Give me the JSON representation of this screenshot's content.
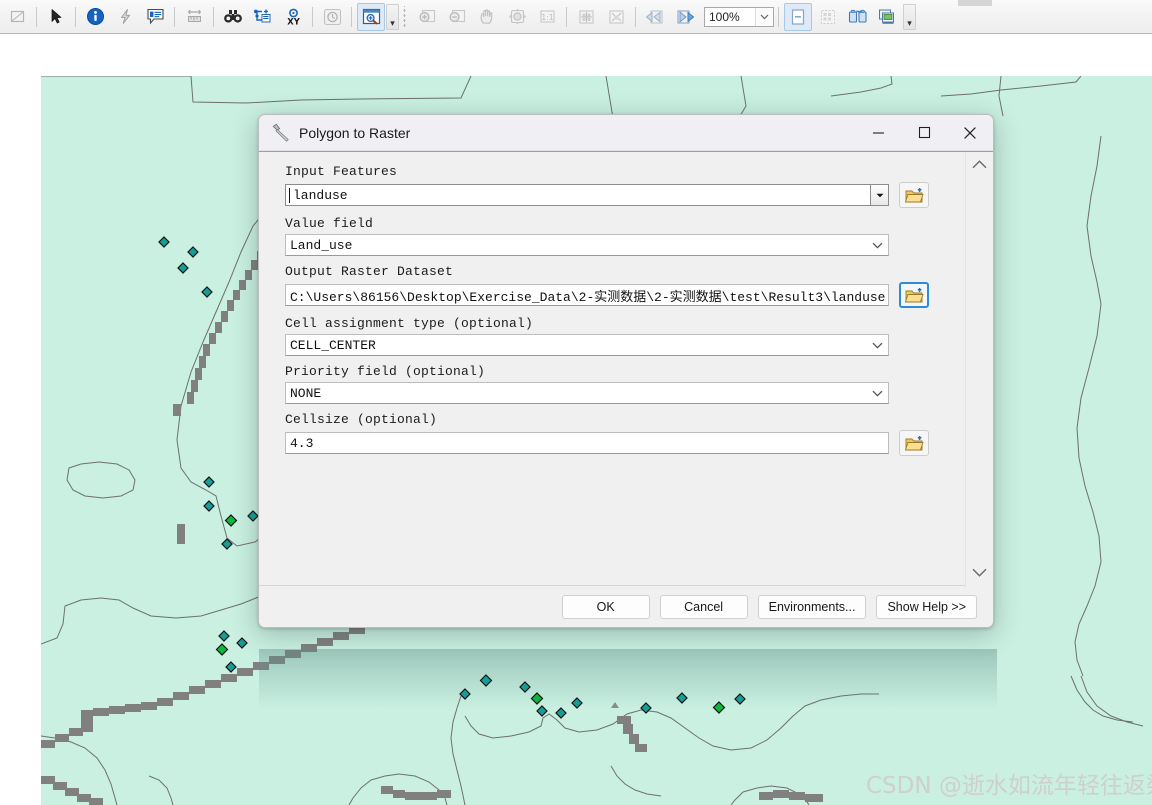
{
  "toolbar": {
    "zoom_level": "100%",
    "items": [
      {
        "icon": "extent-rectangle-icon",
        "label": "Full Extent"
      },
      {
        "icon": "select-arrow-icon",
        "label": "Select Elements"
      },
      {
        "icon": "identify-info-icon",
        "label": "Identify"
      },
      {
        "icon": "hyperlink-lightning-icon",
        "label": "Hyperlink"
      },
      {
        "icon": "html-popup-icon",
        "label": "HTML Popup"
      },
      {
        "icon": "measure-icon",
        "label": "Measure"
      },
      {
        "icon": "find-binoculars-icon",
        "label": "Find"
      },
      {
        "icon": "find-route-icon",
        "label": "Find Route"
      },
      {
        "icon": "go-to-xy-icon",
        "label": "Go To XY"
      },
      {
        "icon": "time-slider-icon",
        "label": "Time Slider"
      },
      {
        "icon": "create-viewer-window-icon",
        "label": "Create Viewer Window"
      },
      {
        "icon": "zoom-in-icon",
        "label": "Zoom In"
      },
      {
        "icon": "zoom-out-icon",
        "label": "Zoom Out"
      },
      {
        "icon": "pan-hand-icon",
        "label": "Pan"
      },
      {
        "icon": "full-extent-globe-icon",
        "label": "Full Extent"
      },
      {
        "icon": "fixed-zoom-1to1-icon",
        "label": "Fixed Zoom"
      },
      {
        "icon": "zoom-in-fixed-icon",
        "label": "Fixed Zoom In"
      },
      {
        "icon": "zoom-out-fixed-icon",
        "label": "Fixed Zoom Out"
      },
      {
        "icon": "go-back-extent-icon",
        "label": "Go Back To Previous Extent"
      },
      {
        "icon": "go-next-extent-icon",
        "label": "Go To Next Extent"
      },
      {
        "icon": "new-page-icon",
        "label": "New Layout"
      },
      {
        "icon": "page-grid-icon",
        "label": "Change Layout"
      },
      {
        "icon": "copy-paste-icon",
        "label": "Copy/Paste"
      },
      {
        "icon": "map-series-icon",
        "label": "Data Driven Pages"
      }
    ]
  },
  "dialog": {
    "title": "Polygon to Raster",
    "title_icon": "hammer-tool-icon",
    "window_buttons": {
      "minimize": "minimize-icon",
      "maximize": "maximize-icon",
      "close": "close-icon"
    },
    "fields": [
      {
        "label": "Input Features",
        "value": "landuse",
        "control": "combobox",
        "has_browse": true,
        "browse_focused": false
      },
      {
        "label": "Value field",
        "value": "Land_use",
        "control": "dropdown",
        "has_browse": false,
        "browse_focused": false
      },
      {
        "label": "Output Raster Dataset",
        "value": "C:\\Users\\86156\\Desktop\\Exercise_Data\\2-实测数据\\2-实测数据\\test\\Result3\\landuse",
        "control": "text",
        "has_browse": true,
        "browse_focused": true
      },
      {
        "label": "Cell assignment type (optional)",
        "value": "CELL_CENTER",
        "control": "dropdown",
        "has_browse": false,
        "browse_focused": false
      },
      {
        "label": "Priority field (optional)",
        "value": "NONE",
        "control": "dropdown",
        "has_browse": false,
        "browse_focused": false
      },
      {
        "label": "Cellsize (optional)",
        "value": "4.3",
        "control": "text",
        "has_browse": true,
        "browse_focused": false
      }
    ],
    "scrollbar": {
      "up": "chevron-up-icon",
      "down": "chevron-down-icon"
    },
    "buttons": {
      "ok": "OK",
      "cancel": "Cancel",
      "environments": "Environments...",
      "show_help": "Show Help >>"
    }
  },
  "watermark": "CSDN @逝水如流年轻往返染尘",
  "map": {
    "layer_fill": "#c9f0e1",
    "boundary_color": "#6b6b6b",
    "thick_boundary_color": "#7a7a7a",
    "point_fill_teal": "#139e97",
    "point_fill_green": "#09b93f",
    "point_outline": "#1b1b1b"
  }
}
